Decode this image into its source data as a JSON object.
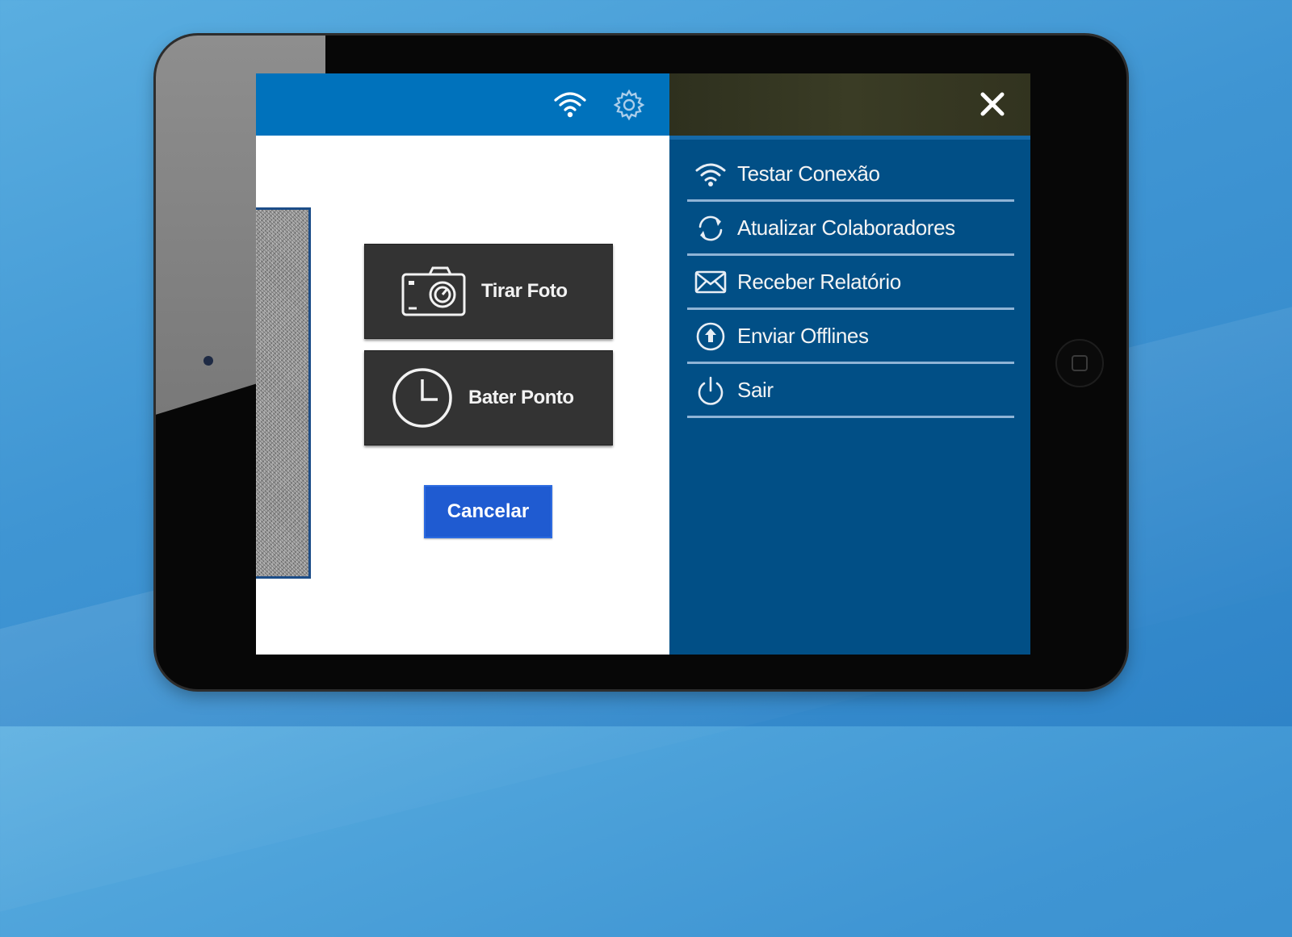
{
  "toolbar": {
    "wifi_icon": "wifi-icon",
    "settings_icon": "gear-icon",
    "bar_color": "#0072bc"
  },
  "actions": {
    "take_photo_label": "Tirar Foto",
    "punch_clock_label": "Bater Ponto",
    "cancel_label": "Cancelar"
  },
  "side_menu": {
    "close_icon": "close-icon",
    "background_color": "#014f86",
    "items": [
      {
        "label": "Testar Conexão",
        "icon": "wifi-icon"
      },
      {
        "label": "Atualizar Colaboradores",
        "icon": "refresh-icon"
      },
      {
        "label": "Receber Relatório",
        "icon": "envelope-icon"
      },
      {
        "label": "Enviar Offlines",
        "icon": "upload-circle-icon"
      },
      {
        "label": "Sair",
        "icon": "power-icon"
      }
    ]
  },
  "colors": {
    "cancel_button": "#1f5bd1",
    "action_button": "#333333"
  }
}
